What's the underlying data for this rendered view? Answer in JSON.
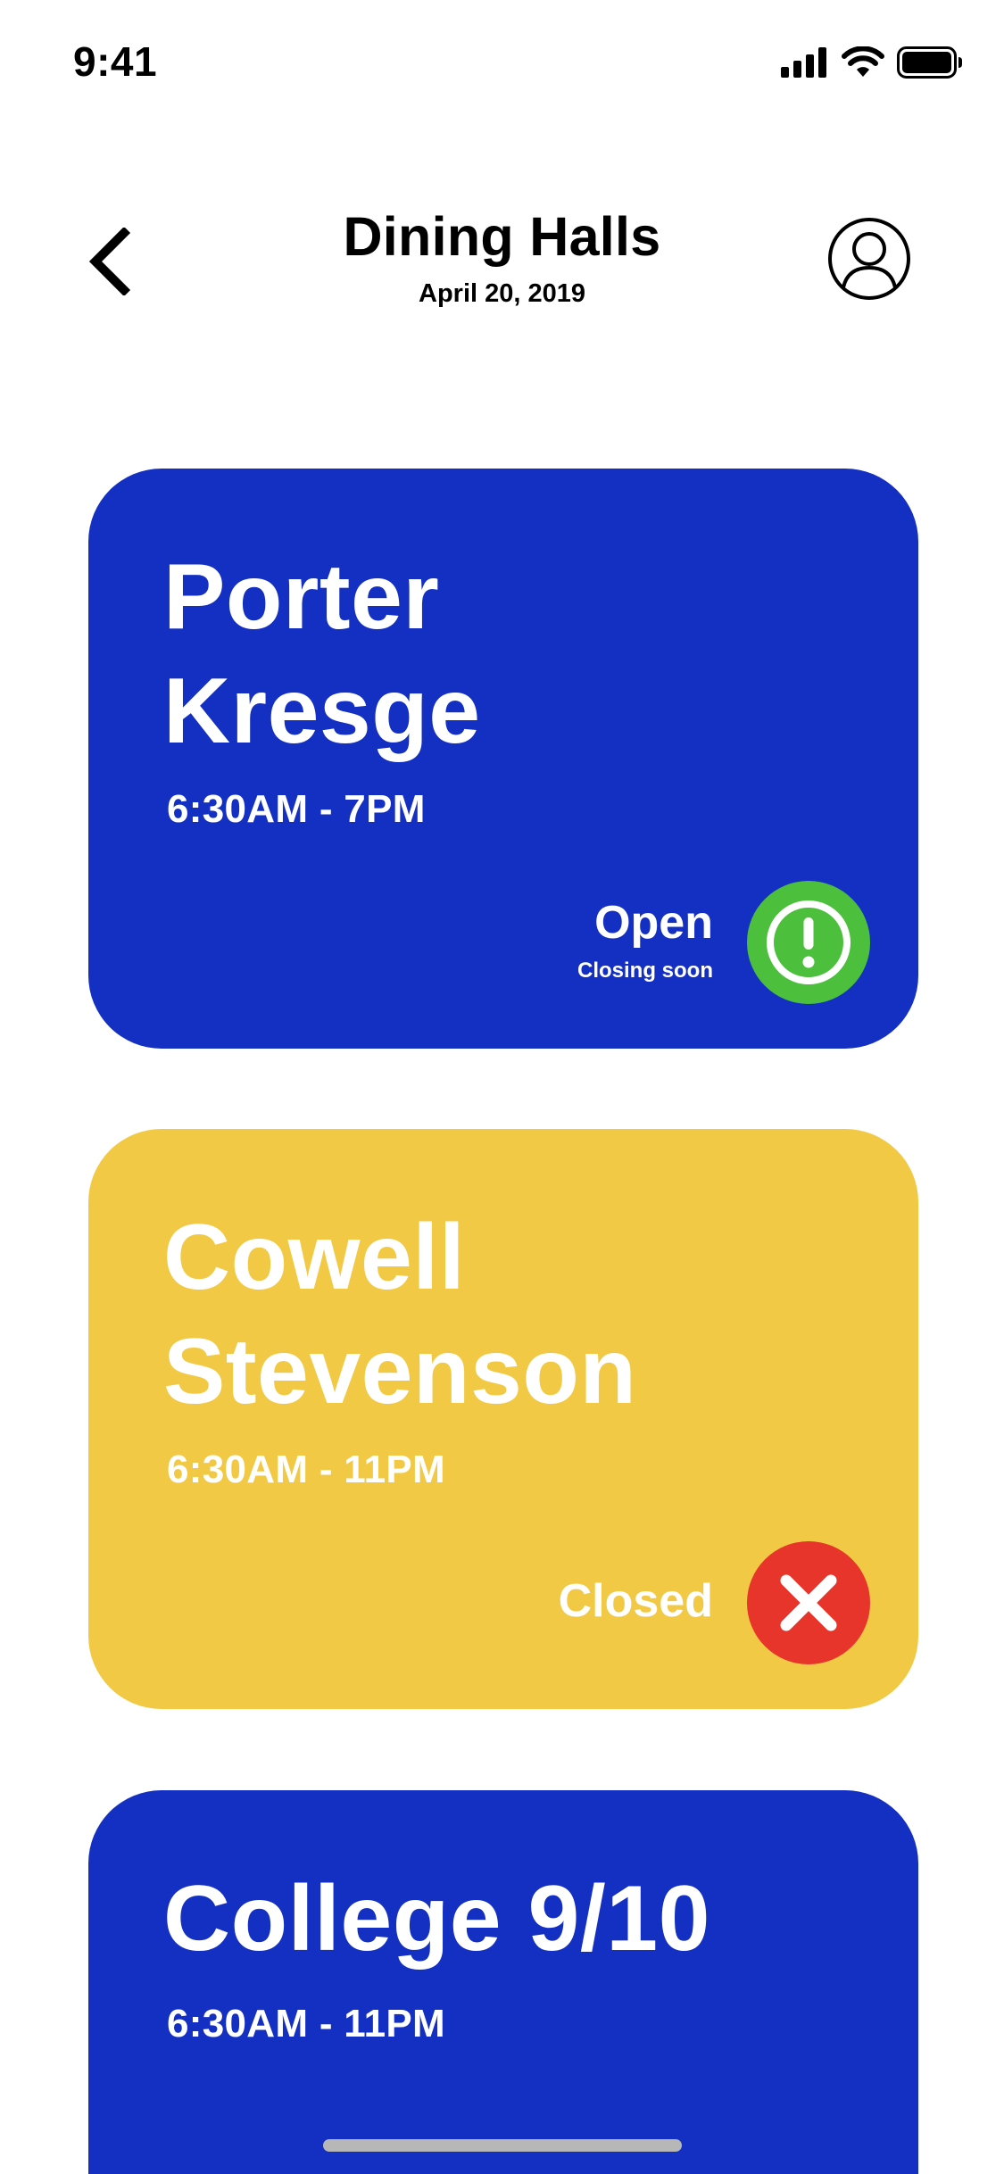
{
  "status_bar": {
    "time": "9:41"
  },
  "header": {
    "title": "Dining Halls",
    "date": "April 20, 2019"
  },
  "halls": [
    {
      "name_line1": "Porter",
      "name_line2": "Kresge",
      "hours": "6:30AM - 7PM",
      "status": "Open",
      "status_note": "Closing soon",
      "color": "#1430c2",
      "status_color": "#4cbf3c",
      "status_icon": "exclamation-icon"
    },
    {
      "name_line1": "Cowell",
      "name_line2": "Stevenson",
      "hours": "6:30AM - 11PM",
      "status": "Closed",
      "color": "#f2c944",
      "status_color": "#e8352b",
      "status_icon": "close-icon"
    },
    {
      "name_line1": "College 9/10",
      "hours": "6:30AM - 11PM",
      "color": "#1430c2"
    }
  ]
}
